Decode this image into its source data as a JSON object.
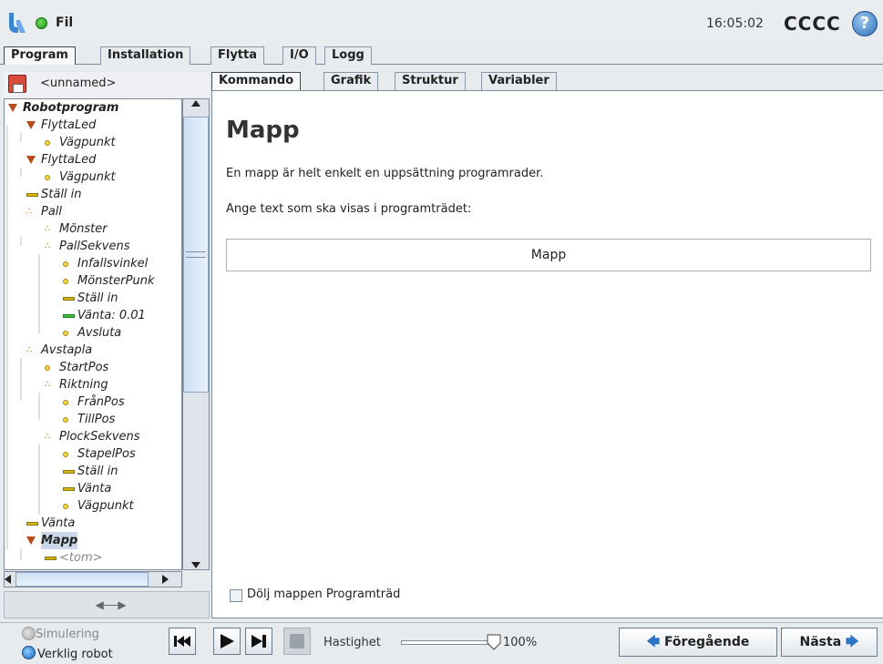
{
  "titlebar": {
    "file_menu": "Fil",
    "clock": "16:05:02",
    "robot_name": "CCCC",
    "help_glyph": "?"
  },
  "main_tabs": [
    "Program",
    "Installation",
    "Flytta",
    "I/O",
    "Logg"
  ],
  "main_tab_active": "Program",
  "program_name": "<unnamed>",
  "sub_tabs": [
    "Kommando",
    "Grafik",
    "Struktur",
    "Variabler"
  ],
  "sub_tab_active": "Kommando",
  "tree": [
    {
      "label": "Robotprogram",
      "icon": "triangle"
    },
    {
      "label": "FlyttaLed",
      "icon": "triangle"
    },
    {
      "label": "Vägpunkt",
      "icon": "waypoint-dot"
    },
    {
      "label": "FlyttaLed",
      "icon": "triangle"
    },
    {
      "label": "Vägpunkt",
      "icon": "waypoint-dot"
    },
    {
      "label": "Ställ in",
      "icon": "yellow-bar"
    },
    {
      "label": "Pall",
      "icon": "pattern"
    },
    {
      "label": "Mönster",
      "icon": "pattern"
    },
    {
      "label": "PallSekvens",
      "icon": "pattern"
    },
    {
      "label": "Infallsvinkel",
      "icon": "waypoint-dot"
    },
    {
      "label": "MönsterPunk",
      "icon": "waypoint-dot"
    },
    {
      "label": "Ställ in",
      "icon": "yellow-bar"
    },
    {
      "label": "Vänta: 0.01",
      "icon": "green-bar"
    },
    {
      "label": "Avsluta",
      "icon": "waypoint-dot"
    },
    {
      "label": "Avstapla",
      "icon": "pattern"
    },
    {
      "label": "StartPos",
      "icon": "waypoint-dot"
    },
    {
      "label": "Riktning",
      "icon": "pattern"
    },
    {
      "label": "FrånPos",
      "icon": "waypoint-dot"
    },
    {
      "label": "TillPos",
      "icon": "waypoint-dot"
    },
    {
      "label": "PlockSekvens",
      "icon": "pattern"
    },
    {
      "label": "StapelPos",
      "icon": "waypoint-dot"
    },
    {
      "label": "Ställ in",
      "icon": "yellow-bar"
    },
    {
      "label": "Vänta",
      "icon": "yellow-bar"
    },
    {
      "label": "Vägpunkt",
      "icon": "waypoint-dot"
    },
    {
      "label": "Vänta",
      "icon": "yellow-bar"
    },
    {
      "label": "Mapp",
      "icon": "triangle",
      "selected": true
    },
    {
      "label": "<tom>",
      "icon": "yellow-bar"
    }
  ],
  "command": {
    "heading": "Mapp",
    "description": "En mapp är helt enkelt en uppsättning programrader.",
    "prompt": "Ange text som ska visas i programträdet:",
    "text_value": "Mapp",
    "hide_checkbox_label": "Dölj mappen Programträd",
    "hide_checked": false
  },
  "footer": {
    "simulation_label": "Simulering",
    "real_robot_label": "Verklig robot",
    "speed_label": "Hastighet",
    "speed_value": "100%",
    "speed_fraction": 1.0,
    "prev_label": "Föregående",
    "next_label": "Nästa"
  },
  "colors": {
    "status_dot": "#3fbf3a",
    "accent_blue": "#2d74c4",
    "selection": "#cbd8ea"
  }
}
